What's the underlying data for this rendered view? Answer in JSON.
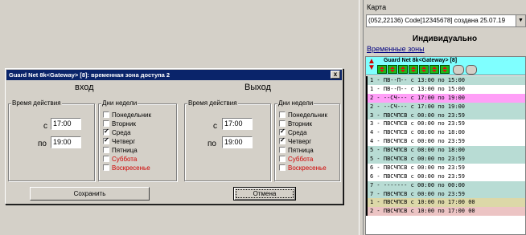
{
  "dialog": {
    "title": "Guard Net  8k<Gateway> [8]: временная зона доступа 2",
    "close_label": "x",
    "entry": {
      "heading": "вход",
      "time_group": "Время действия",
      "from_label": "с",
      "from_value": "17:00",
      "to_label": "по",
      "to_value": "19:00",
      "days_group": "Дни недели",
      "days": [
        {
          "label": "Понедельник",
          "checked": false,
          "weekend": false
        },
        {
          "label": "Вторник",
          "checked": false,
          "weekend": false
        },
        {
          "label": "Среда",
          "checked": true,
          "weekend": false
        },
        {
          "label": "Четверг",
          "checked": true,
          "weekend": false
        },
        {
          "label": "Пятница",
          "checked": false,
          "weekend": false
        },
        {
          "label": "Суббота",
          "checked": false,
          "weekend": true
        },
        {
          "label": "Воскресенье",
          "checked": false,
          "weekend": true
        }
      ]
    },
    "exit": {
      "heading": "Выход",
      "time_group": "Время действия",
      "from_label": "с",
      "from_value": "17:00",
      "to_label": "по",
      "to_value": "19:00",
      "days_group": "Дни недели",
      "days": [
        {
          "label": "Понедельник",
          "checked": false,
          "weekend": false
        },
        {
          "label": "Вторник",
          "checked": false,
          "weekend": false
        },
        {
          "label": "Среда",
          "checked": true,
          "weekend": false
        },
        {
          "label": "Четверг",
          "checked": true,
          "weekend": false
        },
        {
          "label": "Пятница",
          "checked": false,
          "weekend": false
        },
        {
          "label": "Суббота",
          "checked": false,
          "weekend": true
        },
        {
          "label": "Воскресенье",
          "checked": false,
          "weekend": true
        }
      ]
    },
    "save_label": "Сохранить",
    "cancel_label": "Отмена"
  },
  "right_panel": {
    "card_label": "Карта",
    "card_value": "(052,22136) Code[12345678] создана 25.07.19",
    "mode": "Индивидуально",
    "zones_link": "Временные зоны",
    "zone_header": "Guard Net  8k<Gateway> [8]",
    "zone_rows": [
      {
        "text": "1 - ПВ--П-- с 13:00 по 15:00",
        "color": "#b8dcd4"
      },
      {
        "text": "1 - ПВ--П-- с 13:00 по 15:00",
        "color": "#ffffff"
      },
      {
        "text": "2 - --СЧ--- с 17:00 по 19:00",
        "color": "#ff9ff7"
      },
      {
        "text": "2 - --СЧ--- с 17:00 по 19:00",
        "color": "#b8dcd4"
      },
      {
        "text": "3 - ПВСЧПСВ с 00:00 по 23:59",
        "color": "#b8dcd4"
      },
      {
        "text": "3 - ПВСЧПСВ с 00:00 по 23:59",
        "color": "#ffffff"
      },
      {
        "text": "4 - ПВСЧПСВ с 08:00 по 18:00",
        "color": "#ffffff"
      },
      {
        "text": "4 - ПВСЧПСВ с 00:00 по 23:59",
        "color": "#ffffff"
      },
      {
        "text": "5 - ПВСЧПСВ с 08:00 по 18:00",
        "color": "#b8dcd4"
      },
      {
        "text": "5 - ПВСЧПСВ с 00:00 по 23:59",
        "color": "#b8dcd4"
      },
      {
        "text": "6 - ПВСЧПСВ с 00:00 по 23:59",
        "color": "#ffffff"
      },
      {
        "text": "6 - ПВСЧПСВ с 00:00 по 23:59",
        "color": "#ffffff"
      },
      {
        "text": "7 - ------- с 00:00 по 00:00",
        "color": "#b8dcd4"
      },
      {
        "text": "7 - ПВСЧПСВ с 00:00 по 23:59",
        "color": "#b8dcd4"
      },
      {
        "text": "1 - ПВСЧПСВ с 10:00 по 17:00 00",
        "color": "#dcd8a8"
      },
      {
        "text": "2 - ПВСЧПСВ с 10:00 по 17:00 00",
        "color": "#ecc4c4"
      }
    ]
  }
}
